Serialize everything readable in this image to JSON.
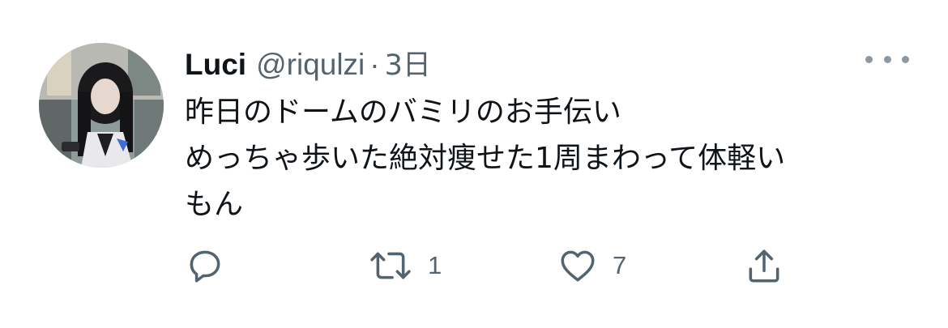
{
  "tweet": {
    "author": {
      "name": "Luci",
      "handle": "@riqulzi",
      "separator": "·",
      "time": "3日"
    },
    "text_lines": [
      "昨日のドームのバミリのお手伝い",
      "めっちゃ歩いた絶対痩せた1周まわって体軽い",
      "もん"
    ],
    "actions": {
      "reply": {
        "icon": "reply-icon",
        "count": ""
      },
      "retweet": {
        "icon": "retweet-icon",
        "count": "1"
      },
      "like": {
        "icon": "heart-icon",
        "count": "7"
      },
      "share": {
        "icon": "share-icon"
      }
    },
    "more_icon": "more-options-icon"
  },
  "colors": {
    "primary_text": "#0f1419",
    "secondary_text": "#536471",
    "icon": "#536471",
    "background": "#ffffff"
  }
}
